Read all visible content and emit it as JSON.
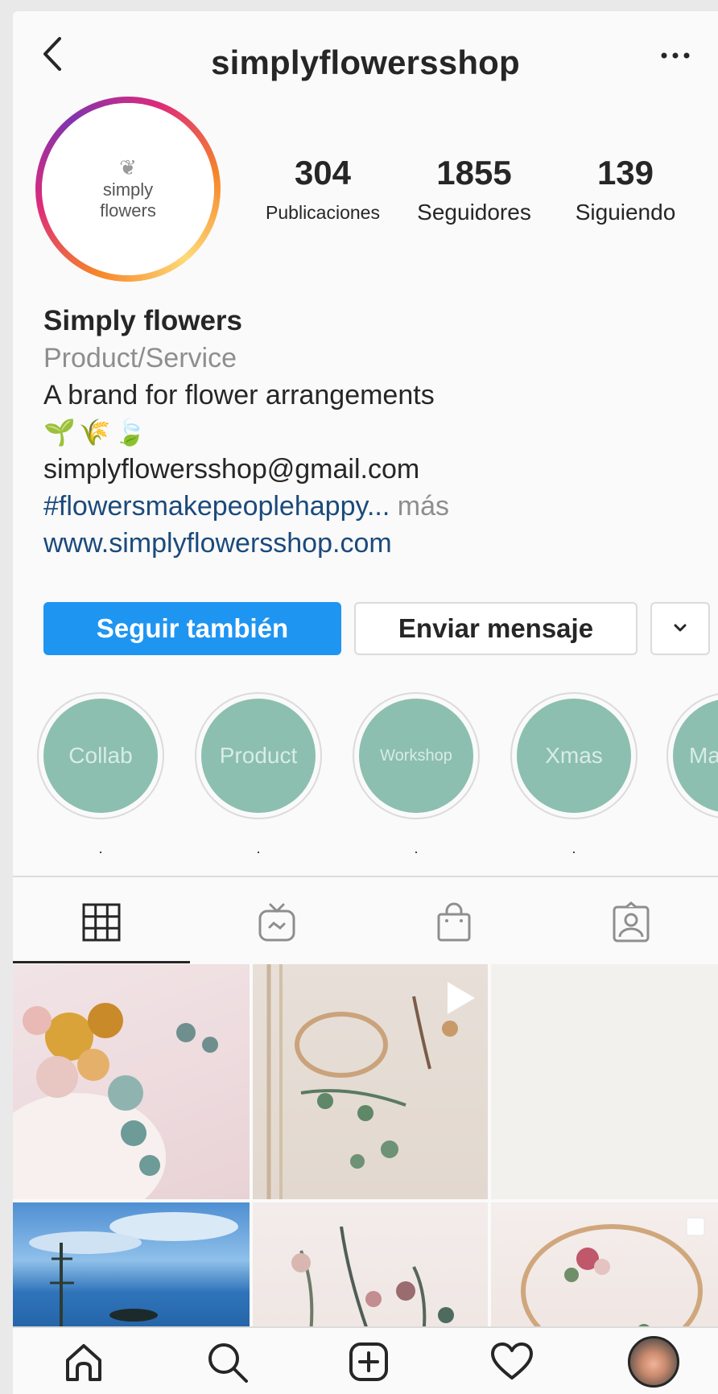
{
  "header": {
    "username": "simplyflowersshop",
    "back_icon": "chevron-left-icon",
    "more_icon": "ellipsis-icon"
  },
  "profile": {
    "avatar_text_line1": "simply",
    "avatar_text_line2": "flowers",
    "stats": [
      {
        "value": "304",
        "label": "Publicaciones"
      },
      {
        "value": "1855",
        "label": "Seguidores"
      },
      {
        "value": "139",
        "label": "Siguiendo"
      }
    ]
  },
  "bio": {
    "name": "Simply flowers",
    "category": "Product/Service",
    "description": "A brand for flower arrangements",
    "emojis": "🌱🌾🍃",
    "email": "simplyflowersshop@gmail.com",
    "hashtag": "#flowersmakepeoplehappy",
    "ellipsis": "...",
    "more": " más",
    "website": "www.simplyflowersshop.com"
  },
  "actions": {
    "follow_label": "Seguir también",
    "message_label": "Enviar mensaje",
    "dropdown_icon": "chevron-down-icon"
  },
  "highlights": [
    {
      "title": "Collab",
      "label": "·"
    },
    {
      "title": "Product",
      "label": "·"
    },
    {
      "title": "Workshop",
      "label": "·"
    },
    {
      "title": "Xmas",
      "label": "·"
    },
    {
      "title": "Ma",
      "label": ""
    }
  ],
  "colors": {
    "accent": "#1f95f2",
    "highlight": "#8cbfaf",
    "link": "#1b4a7c"
  },
  "tabs": [
    {
      "icon": "grid-icon",
      "active": true
    },
    {
      "icon": "igtv-icon",
      "active": false
    },
    {
      "icon": "shop-bag-icon",
      "active": false
    },
    {
      "icon": "tagged-icon",
      "active": false
    }
  ],
  "posts": [
    {
      "kind": "image",
      "subject": "dried flower arrangement"
    },
    {
      "kind": "video",
      "subject": "embroidery hoop with eucalyptus"
    },
    {
      "kind": "blank",
      "subject": ""
    },
    {
      "kind": "image",
      "subject": "sea and sky"
    },
    {
      "kind": "image",
      "subject": "dried flowers"
    },
    {
      "kind": "carousel",
      "subject": "floral hoop wreath"
    }
  ],
  "nav": [
    {
      "icon": "home-icon"
    },
    {
      "icon": "search-icon"
    },
    {
      "icon": "add-post-icon"
    },
    {
      "icon": "heart-icon"
    },
    {
      "icon": "profile-avatar-icon"
    }
  ]
}
